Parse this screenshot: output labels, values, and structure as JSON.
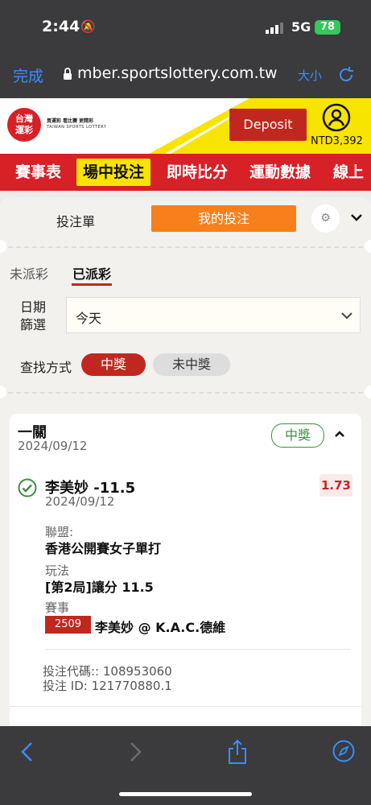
{
  "status_bar": {
    "time": "2:44",
    "network": "5G",
    "battery": "78"
  },
  "browser": {
    "done_label": "完成",
    "url": "mber.sportslottery.com.tw",
    "text_size_label": "大小"
  },
  "header": {
    "logo_text": "台灣\n運彩",
    "tagline": "買運彩 看比賽 更精彩",
    "subline": "TAIWAN SPORTS LOTTERY",
    "deposit_label": "Deposit",
    "balance": "NTD3,392"
  },
  "nav": {
    "items": [
      "賽事表",
      "場中投注",
      "即時比分",
      "運動數據",
      "線上"
    ]
  },
  "tabs": {
    "slip": "投注單",
    "my_bets": "我的投注"
  },
  "subtabs": {
    "unsettled": "未派彩",
    "settled": "已派彩"
  },
  "filters": {
    "date_label": "日期\n篩選",
    "date_value": "今天",
    "search_label": "查找方式",
    "win": "中獎",
    "lose": "未中獎"
  },
  "bet": {
    "type": "一關",
    "date": "2024/09/12",
    "result": "中獎",
    "selection": "李美妙 -11.5",
    "selection_date": "2024/09/12",
    "odds": "1.73",
    "league_label": "聯盟:",
    "league_value": "香港公開賽女子單打",
    "market_label": "玩法",
    "market_value": "[第2局]讓分 11.5",
    "event_label": "賽事",
    "event_code": "2509",
    "event_name": "李美妙 @ K.A.C.德維",
    "bet_code": "投注代碼:: 108953060",
    "bet_id": "投注 ID: 121770880.1"
  },
  "colors": {
    "brand_red": "#d82027",
    "accent_orange": "#f7801d",
    "highlight_yellow": "#f9e400",
    "win_green": "#3f8f3f"
  }
}
